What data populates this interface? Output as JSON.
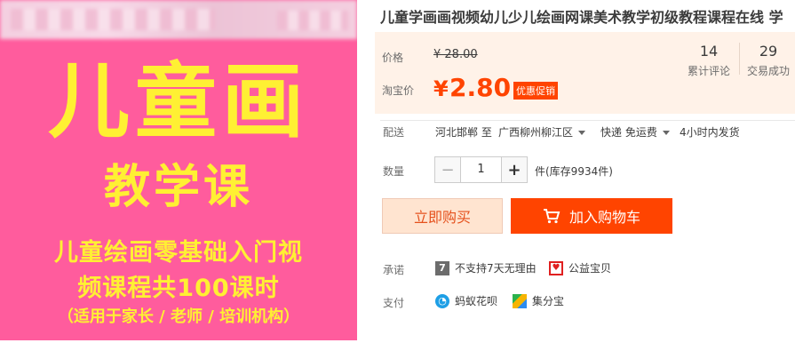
{
  "product_image": {
    "title": "儿童画",
    "subtitle": "教学课",
    "line1": "儿童绘画零基础入门视",
    "line2": "频课程共100课时",
    "line3": "（适用于家长 / 老师 / 培训机构）"
  },
  "product": {
    "title": "儿童学画画视频幼儿少儿绘画网课美术教学初级教程课程在线 学"
  },
  "price": {
    "label": "价格",
    "original": "¥ 28.00",
    "taobao_label": "淘宝价",
    "currency": "¥",
    "current": "2.80",
    "promo_tag": "优惠促销"
  },
  "stats": {
    "reviews_count": "14",
    "reviews_label": "累计评论",
    "sales_count": "29",
    "sales_label": "交易成功"
  },
  "delivery": {
    "label": "配送",
    "from": "河北邯郸 至",
    "to": "广西柳州柳江区",
    "method": "快递 免运费",
    "ship_time": "4小时内发货"
  },
  "quantity": {
    "label": "数量",
    "value": "1",
    "minus": "−",
    "plus": "+",
    "stock": "件(库存9934件)"
  },
  "actions": {
    "buy_now": "立即购买",
    "add_cart": "加入购物车"
  },
  "promise": {
    "label": "承诺",
    "item1": "不支持7天无理由",
    "item2": "公益宝贝"
  },
  "payment": {
    "label": "支付",
    "item1": "蚂蚁花呗",
    "item2": "集分宝"
  },
  "colors": {
    "accent": "#ff4400",
    "image_bg": "#ff5c9d",
    "image_text": "#fff033",
    "price_box_bg": "#fff2e8"
  }
}
